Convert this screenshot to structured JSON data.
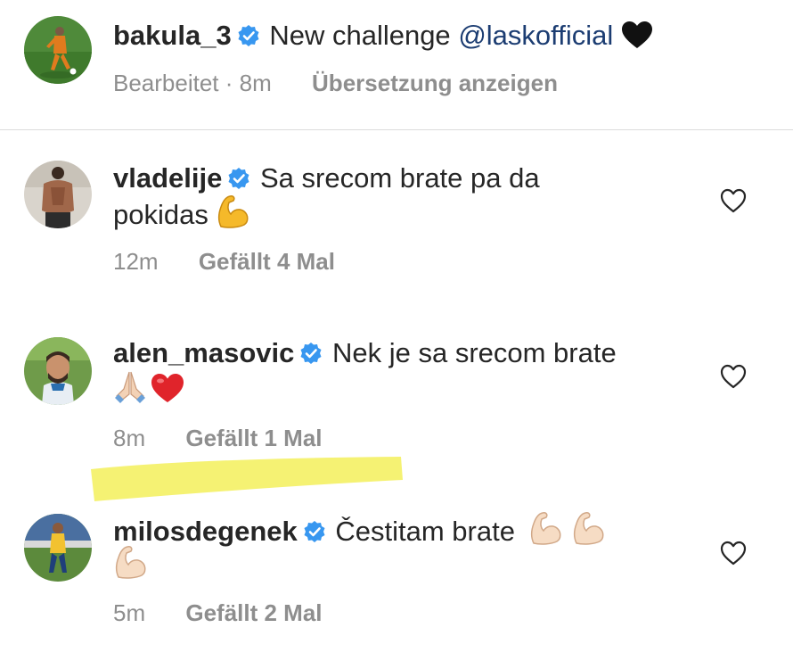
{
  "caption": {
    "username": "bakula_3",
    "text": "New challenge",
    "mention": "@laskofficial",
    "emoji": "black-heart",
    "edited_label": "Bearbeitet",
    "separator": "·",
    "time": "8m",
    "translate_label": "Übersetzung anzeigen"
  },
  "comments": [
    {
      "username": "vladelije",
      "text_line1": "Sa srecom brate pa da",
      "text_line2": "pokidas",
      "emojis": [
        "flexed-biceps"
      ],
      "time": "12m",
      "likes_label": "Gefällt 4 Mal"
    },
    {
      "username": "alen_masovic",
      "text_line1": "Nek je sa srecom brate",
      "text_line2": "",
      "emojis": [
        "folded-hands",
        "red-heart"
      ],
      "time": "8m",
      "likes_label": "Gefällt 1 Mal"
    },
    {
      "username": "milosdegenek",
      "text_line1": "Čestitam brate",
      "text_line2": "",
      "emojis": [
        "flexed-biceps-light",
        "flexed-biceps-light",
        "flexed-biceps-light"
      ],
      "time": "5m",
      "likes_label": "Gefällt 2 Mal"
    }
  ],
  "colors": {
    "verified": "#3897f0",
    "mention": "#1c3d72",
    "meta_text": "#8e8e8e",
    "highlight": "#f3f05a"
  }
}
